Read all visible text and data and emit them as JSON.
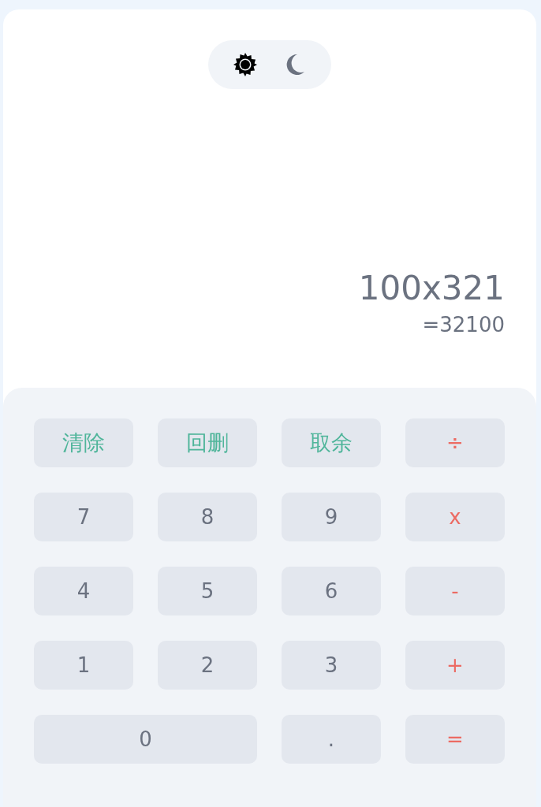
{
  "theme_toggle": [
    {
      "kind": "sun",
      "selected": true
    },
    {
      "kind": "moon",
      "selected": false
    }
  ],
  "display": {
    "expression": "100x321",
    "result": "=32100"
  },
  "keys": [
    {
      "label": "清除",
      "kind": "function"
    },
    {
      "label": "回删",
      "kind": "function"
    },
    {
      "label": "取余",
      "kind": "function"
    },
    {
      "label": "÷",
      "kind": "operator"
    },
    {
      "label": "7",
      "kind": "digit"
    },
    {
      "label": "8",
      "kind": "digit"
    },
    {
      "label": "9",
      "kind": "digit"
    },
    {
      "label": "x",
      "kind": "operator"
    },
    {
      "label": "4",
      "kind": "digit"
    },
    {
      "label": "5",
      "kind": "digit"
    },
    {
      "label": "6",
      "kind": "digit"
    },
    {
      "label": "-",
      "kind": "operator"
    },
    {
      "label": "1",
      "kind": "digit"
    },
    {
      "label": "2",
      "kind": "digit"
    },
    {
      "label": "3",
      "kind": "digit"
    },
    {
      "label": "+",
      "kind": "operator"
    },
    {
      "label": "0",
      "kind": "wide"
    },
    {
      "label": ".",
      "kind": "digit"
    },
    {
      "label": "=",
      "kind": "operator"
    }
  ]
}
